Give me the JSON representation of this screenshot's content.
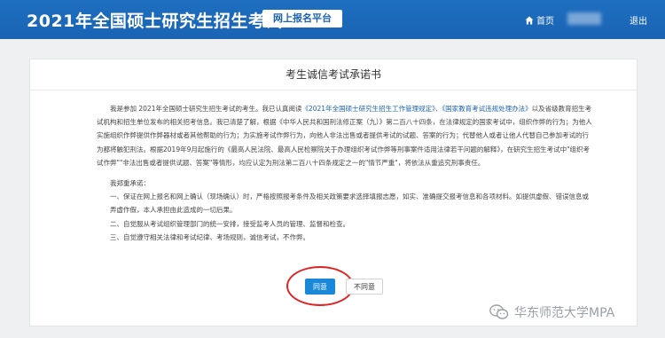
{
  "header": {
    "brand_title": "2021年全国硕士研究生招生考试",
    "platform_tag": "网上报名平台",
    "home_label": "首页",
    "logout_label": "退出"
  },
  "card": {
    "title": "考生诚信考试承诺书",
    "para1": {
      "pre": "我是参加 2021年全国硕士研究生招生考试的考生。我已认真阅读",
      "link1": "《2021年全国硕士研究生招生工作管理规定》",
      "mid": "、",
      "link2": "《国家教育考试违规处理办法》",
      "post": "以及省级教育招生考试机构和招生单位发布的相关招考信息。我已清楚了解，根据《中华人民共和国刑法修正案（九）》第二百八十四条，在法律规定的国家考试中，组织作弊的行为；为他人实施组织作弊提供作弊器材或者其他帮助的行为；为实施考试作弊行为，向他人非法出售或者提供考试的试题、答案的行为；代替他人或者让他人代替自己参加考试的行为都将触犯刑法。根据2019年9月起施行的《最高人民法院、最高人民检察院关于办理组织考试作弊等刑事案件适用法律若干问题的解释》，在研究生招生考试中\"组织考试作弊\"\"非法出售或者提供试题、答案\"等情形，均应认定为刑法第二百八十四条规定之一的\"情节严重\"，将依法从重追究刑事责任。"
    },
    "pledge_heading": "我郑重承诺：",
    "pledge_items": [
      "一、保证在网上报名和网上确认（现场确认）时，严格按照报考条件及相关政策要求选择填报志愿，如实、准确提交报考信息和各项材料。如提供虚假、错误信息或弄虚作假，本人承担由此造成的一切后果。",
      "二、自觉服从考试组织管理部门的统一安排，接受监考人员的管理、监督和检查。",
      "三、自觉遵守相关法律和考试纪律、考场规则，诚信考试，不作弊。"
    ],
    "agree_label": "同意",
    "disagree_label": "不同意"
  },
  "watermark": {
    "text": "华东师范大学MPA",
    "icon": "wechat-icon"
  },
  "colors": {
    "header_bg": "#1a63b3",
    "link": "#1a63b3",
    "agree_bg": "#1a88d8",
    "highlight": "#e02323"
  }
}
